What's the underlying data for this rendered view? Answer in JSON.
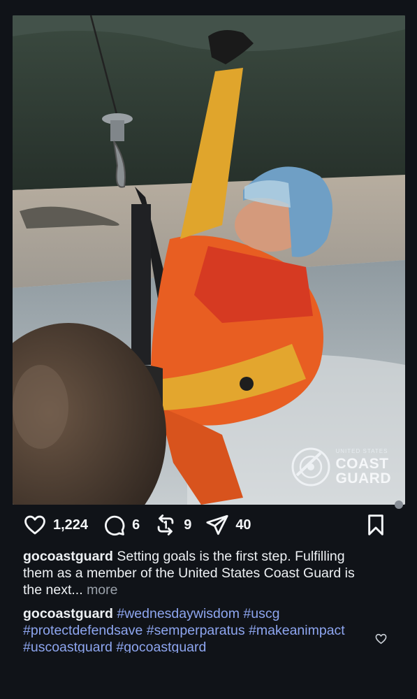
{
  "post": {
    "image_alt": "Coast Guard rescue swimmer in orange dry suit and blue helmet suspended from a hoist cable above a beach",
    "watermark": {
      "line1": "UNITED STATES",
      "line2": "COAST",
      "line3": "GUARD"
    }
  },
  "actions": {
    "likes": "1,224",
    "comments": "6",
    "reposts": "9",
    "shares": "40"
  },
  "caption": {
    "username": "gocoastguard",
    "text": "Setting goals is the first step. Fulfilling them as a member of the United States Coast Guard is the next...",
    "more": "more"
  },
  "comment": {
    "username": "gocoastguard",
    "hashtags": [
      "#wednesdaywisdom",
      "#uscg",
      "#protectdefendsave",
      "#semperparatus",
      "#makeanimpact",
      "#uscoastguard",
      "#gocoastguard"
    ]
  },
  "icons": {
    "like": "heart-icon",
    "comment": "comment-bubble-icon",
    "repost": "repost-icon",
    "share": "send-icon",
    "save": "bookmark-icon"
  },
  "colors": {
    "background": "#101318",
    "hashtag": "#8ea6f0",
    "text": "#eef1f4"
  }
}
